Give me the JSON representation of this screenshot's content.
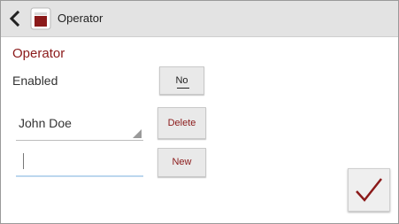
{
  "actionbar": {
    "title": "Operator",
    "back_icon": "chevron-left-icon",
    "app_icon": "app-icon"
  },
  "section": {
    "title": "Operator"
  },
  "enabled": {
    "label": "Enabled",
    "toggle_label": "No"
  },
  "operator_select": {
    "selected": "John Doe"
  },
  "name_input": {
    "value": ""
  },
  "buttons": {
    "delete_label": "Delete",
    "new_label": "New",
    "confirm_icon": "checkmark-icon"
  },
  "colors": {
    "accent": "#8b1a1a",
    "actionbar_bg": "#e3e3e3",
    "input_underline": "#bcd7ee"
  }
}
